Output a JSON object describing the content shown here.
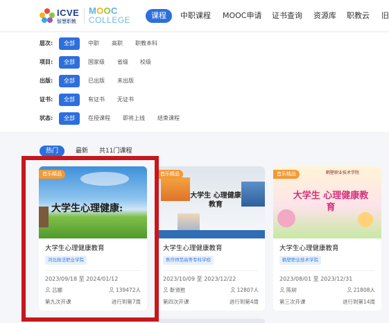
{
  "header": {
    "icve_brand": "icve",
    "icve_sub": "智慧职教",
    "mooc_top": "MOOC",
    "mooc_bottom": "COLLEGE",
    "nav": [
      "课程",
      "中职课程",
      "MOOC申请",
      "证书查询",
      "资源库",
      "职教云",
      "旧"
    ]
  },
  "filters": [
    {
      "label": "层次:",
      "options": [
        "全部",
        "中职",
        "高职",
        "职教本科"
      ]
    },
    {
      "label": "项目:",
      "options": [
        "全部",
        "国家级",
        "省级",
        "校级"
      ]
    },
    {
      "label": "出版:",
      "options": [
        "全部",
        "已出版",
        "未出版"
      ]
    },
    {
      "label": "证书:",
      "options": [
        "全部",
        "有证书",
        "无证书"
      ]
    },
    {
      "label": "状态:",
      "options": [
        "全部",
        "在授课程",
        "即将上线",
        "结束课程"
      ]
    }
  ],
  "tabs": [
    "热门",
    "最新",
    "共11门课程"
  ],
  "cards": [
    {
      "badge": "首乐精品",
      "cover_text": "大学生心理健康:",
      "title": "大学生心理健康教育",
      "school": "河北政法职业学院",
      "date": "2023/09/18 至 2024/01/12",
      "teacher": "吕娜",
      "count": "139472人",
      "session": "第九次开课",
      "progress": "进行到第7周"
    },
    {
      "badge": "首乐精品",
      "cover_text": "大学生 心理健康教育",
      "title": "大学生心理健康教育",
      "school": "焦作师范高等专科学校",
      "date": "2023/10/09 至 2023/12/22",
      "teacher": "靳贤胜",
      "count": "12807人",
      "session": "第四次开课",
      "progress": "进行到第4周"
    },
    {
      "badge": "首乐精品",
      "cover_text": "大学生 心理健康教育",
      "cover_org": "鹤壁职业技术学院",
      "title": "大学生心理健康教育",
      "school": "鹤壁职业技术学院",
      "date": "2023/08/01 至 2023/12/31",
      "teacher": "陈树",
      "count": "21808人",
      "session": "第三次开课",
      "progress": "进行到第14周"
    }
  ],
  "colors": {
    "accent": "#2d6fdc",
    "badge": "#f29a36",
    "highlight": "#c8161d"
  }
}
